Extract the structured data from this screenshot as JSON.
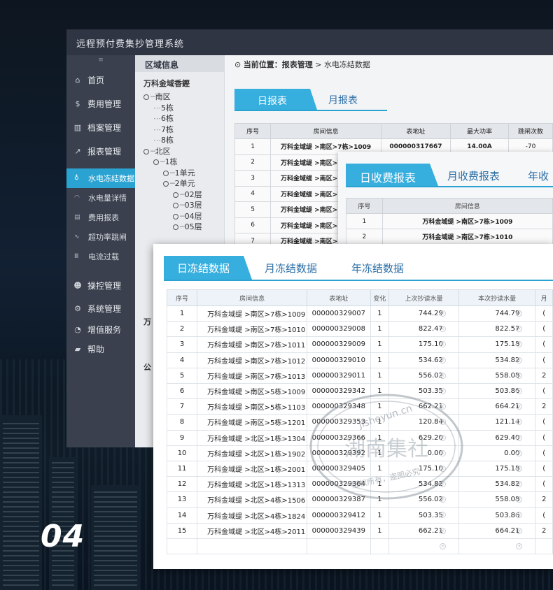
{
  "page_label": "04",
  "app": {
    "title": "远程预付费集抄管理系统",
    "sidebar": {
      "grip": "≡",
      "items": [
        {
          "label": "首页",
          "icon": "home-icon"
        },
        {
          "label": "费用管理",
          "icon": "dollar-icon"
        },
        {
          "label": "档案管理",
          "icon": "archive-icon"
        },
        {
          "label": "报表管理",
          "icon": "chart-icon"
        }
      ],
      "subitems": [
        {
          "label": "水电冻结数据",
          "icon": "pin-icon",
          "active": true
        },
        {
          "label": "水电量详情",
          "icon": "drop-icon"
        },
        {
          "label": "费用报表",
          "icon": "doc-icon"
        },
        {
          "label": "超功率跳闸",
          "icon": "wave-icon"
        },
        {
          "label": "电流过载",
          "icon": "bars-icon"
        }
      ],
      "items2": [
        {
          "label": "操控管理",
          "icon": "user-icon"
        },
        {
          "label": "系统管理",
          "icon": "settings-icon"
        },
        {
          "label": "增值服务",
          "icon": "clock-icon"
        },
        {
          "label": "帮助",
          "icon": "briefcase-icon"
        }
      ]
    },
    "tree": {
      "header": "区域信息",
      "root": "万科金域香鏗",
      "nodes": [
        "南区",
        "5栋",
        "6栋",
        "7栋",
        "8栋",
        "北区",
        "1栋",
        "1单元",
        "2单元",
        "02层",
        "03层",
        "04层",
        "05层"
      ],
      "tail_a": "万",
      "tail_b": "公"
    },
    "breadcrumb": {
      "prefix": "当前位置：",
      "section": "报表管理",
      "sep": " > ",
      "page": "水电冻结数据"
    },
    "tabs": [
      "日报表",
      "月报表"
    ],
    "table": {
      "headers": [
        "序号",
        "房间信息",
        "表地址",
        "最大功率",
        "跳闸次数"
      ],
      "rows": [
        [
          "1",
          "万科金域缇 >南区>7栋>1009",
          "000000317667",
          "14.00A",
          "-70"
        ],
        [
          "2",
          "万科金域缇 >南区>7栋>1010",
          "",
          "",
          ""
        ],
        [
          "3",
          "万科金域缇 >南区>7栋>1011",
          "",
          "",
          ""
        ],
        [
          "4",
          "万科金域缇 >南区>7栋>1012",
          "",
          "",
          ""
        ],
        [
          "5",
          "万科金域缇 >南区>7栋>1013",
          "",
          "",
          ""
        ],
        [
          "6",
          "万科金域缇 >南区>5栋>1009",
          "",
          "",
          ""
        ],
        [
          "7",
          "万科金域缇 >南区>5栋>1103",
          "",
          "",
          ""
        ]
      ]
    }
  },
  "panel2": {
    "tabs": [
      "日收费报表",
      "月收费报表",
      "年收"
    ],
    "headers": [
      "序号",
      "房间信息"
    ],
    "rows": [
      [
        "1",
        "万科金域缇 >南区>7栋>1009"
      ],
      [
        "2",
        "万科金域缇 >南区>7栋>1010"
      ]
    ]
  },
  "panel3": {
    "tabs": [
      "日冻结数据",
      "月冻结数据",
      "年冻结数据"
    ],
    "headers": [
      "序号",
      "房间信息",
      "表地址",
      "变化",
      "上次抄读水量",
      "本次抄读水量",
      "月"
    ],
    "rows": [
      [
        "1",
        "万科金域缇 >南区>7栋>1009",
        "000000329007",
        "1",
        "744.29",
        "744.79",
        "("
      ],
      [
        "2",
        "万科金域缇 >南区>7栋>1010",
        "000000329008",
        "1",
        "822.47",
        "822.57",
        "("
      ],
      [
        "3",
        "万科金域缇 >南区>7栋>1011",
        "000000329009",
        "1",
        "175.10",
        "175.18",
        "("
      ],
      [
        "4",
        "万科金域缇 >南区>7栋>1012",
        "000000329010",
        "1",
        "534.62",
        "534.82",
        "("
      ],
      [
        "5",
        "万科金域缇 >南区>7栋>1013",
        "000000329011",
        "1",
        "556.02",
        "558.08",
        "2"
      ],
      [
        "6",
        "万科金域缇 >南区>5栋>1009",
        "000000329342",
        "1",
        "503.35",
        "503.86",
        "("
      ],
      [
        "7",
        "万科金域缇 >南区>5栋>1103",
        "000000329348",
        "1",
        "662.21",
        "664.21",
        "2"
      ],
      [
        "8",
        "万科金域缇 >南区>5栋>1201",
        "000000329353",
        "1",
        "120.84",
        "121.14",
        "("
      ],
      [
        "9",
        "万科金域缇 >北区>1栋>1304",
        "000000329366",
        "1",
        "629.20",
        "629.40",
        "("
      ],
      [
        "10",
        "万科金域缇 >北区>1栋>1902",
        "000000329392",
        "1",
        "0.00",
        "0.00",
        "("
      ],
      [
        "11",
        "万科金域缇 >北区>1栋>2001",
        "000000329405",
        "1",
        "175.10",
        "175.18",
        "("
      ],
      [
        "12",
        "万科金域缇 >北区>1栋>1313",
        "000000329364",
        "1",
        "534.82",
        "534.82",
        "("
      ],
      [
        "13",
        "万科金域缇 >北区>4栋>1506",
        "000000329387",
        "1",
        "556.02",
        "558.08",
        "2"
      ],
      [
        "14",
        "万科金域缇 >北区>4栋>1824",
        "000000329412",
        "1",
        "503.35",
        "503.86",
        "("
      ],
      [
        "15",
        "万科金域缇 >北区>4栋>2011",
        "000000329439",
        "1",
        "662.21",
        "664.21",
        "2"
      ]
    ]
  },
  "watermark": {
    "top": "jisheyun.cn",
    "middle": "湖南集社",
    "bottom": "版权所有，盗图必究"
  },
  "colors": {
    "accent": "#36aede",
    "sidebar": "#3a404d",
    "titlebar": "#2f3542",
    "tab_text": "#2c6fa6"
  }
}
